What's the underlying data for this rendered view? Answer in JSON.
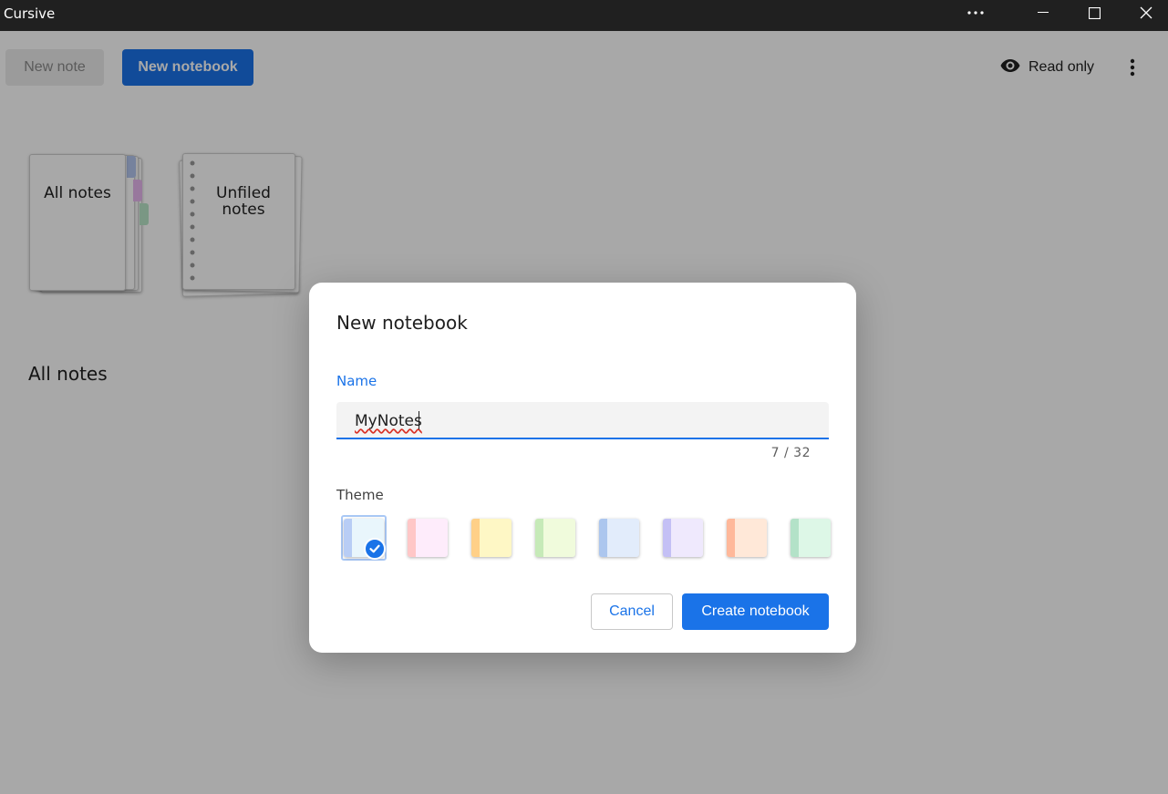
{
  "window": {
    "title": "Cursive",
    "more_icon": "more-horizontal-icon",
    "minimize_icon": "minimize-icon",
    "maximize_icon": "maximize-icon",
    "close_icon": "close-icon"
  },
  "toolbar": {
    "new_note_label": "New note",
    "new_note_enabled": false,
    "new_notebook_label": "New notebook",
    "read_only_label": "Read only",
    "read_only_icon": "eye-icon",
    "menu_icon": "more-vertical-icon"
  },
  "notebooks": [
    {
      "label": "All notes",
      "style": "tabbed",
      "tab_colors": [
        "#b3c6ee",
        "#e7b7ee",
        "#b9e6c8"
      ]
    },
    {
      "label": "Unfiled notes",
      "style": "ringed"
    }
  ],
  "section_title": "All notes",
  "dialog": {
    "title": "New notebook",
    "name_label": "Name",
    "name_value": "MyNotes",
    "char_count": "7 / 32",
    "theme_label": "Theme",
    "themes": [
      {
        "spine": "#b8cdf5",
        "cover": "#e9f6fc",
        "selected": true
      },
      {
        "spine": "#ffc7c7",
        "cover": "#feecfb",
        "selected": false
      },
      {
        "spine": "#ffd088",
        "cover": "#fef7c5",
        "selected": false
      },
      {
        "spine": "#c6eab8",
        "cover": "#f0fbdc",
        "selected": false
      },
      {
        "spine": "#acc6ee",
        "cover": "#e2ecfb",
        "selected": false
      },
      {
        "spine": "#c4c0f5",
        "cover": "#efe9fd",
        "selected": false
      },
      {
        "spine": "#ffb89a",
        "cover": "#ffe8d8",
        "selected": false
      },
      {
        "spine": "#b3e2c8",
        "cover": "#ddf7e7",
        "selected": false
      }
    ],
    "cancel_label": "Cancel",
    "create_label": "Create notebook",
    "accent": "#1a73e8"
  }
}
